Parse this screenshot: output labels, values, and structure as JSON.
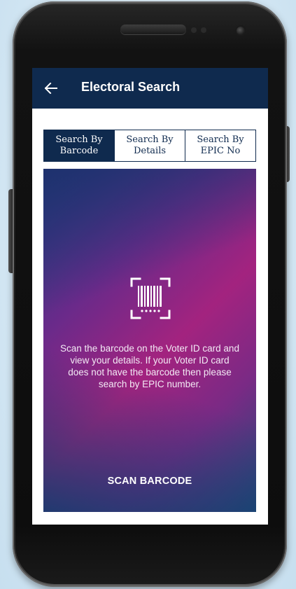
{
  "app": {
    "title": "Electoral Search"
  },
  "tabs": [
    {
      "label": "Search By\nBarcode",
      "active": true
    },
    {
      "label": "Search By\nDetails",
      "active": false
    },
    {
      "label": "Search By\nEPIC No",
      "active": false
    }
  ],
  "scan_panel": {
    "instructions": "Scan the barcode on the Voter ID card and view your details. If your Voter ID card does not have the barcode then please search by EPIC number.",
    "button_label": "SCAN BARCODE"
  },
  "icons": {
    "back": "arrow-left-icon",
    "barcode": "barcode-scan-icon"
  },
  "colors": {
    "appbar": "#0f2a4e",
    "tab_active_bg": "#0f2a4e",
    "tab_active_text": "#ffffff",
    "panel_gradient_start": "#2a3a85",
    "panel_gradient_mid": "#a3237f",
    "panel_gradient_end": "#1f4a78"
  }
}
